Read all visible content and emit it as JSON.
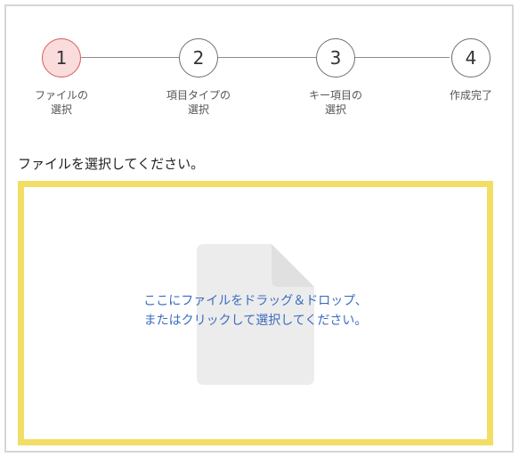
{
  "stepper": {
    "steps": [
      {
        "number": "1",
        "label": "ファイルの\n選択"
      },
      {
        "number": "2",
        "label": "項目タイプの\n選択"
      },
      {
        "number": "3",
        "label": "キー項目の\n選択"
      },
      {
        "number": "4",
        "label": "作成完了"
      }
    ],
    "active_step": 1
  },
  "instruction": "ファイルを選択してください。",
  "dropzone": {
    "line1": "ここにファイルをドラッグ＆ドロップ、",
    "line2": "またはクリックして選択してください。",
    "icon": "document-icon"
  },
  "colors": {
    "active_step_fill": "#fbdcdc",
    "active_step_border": "#d65a5a",
    "dropzone_border": "#f2de66",
    "link_text": "#3b6cc0"
  }
}
